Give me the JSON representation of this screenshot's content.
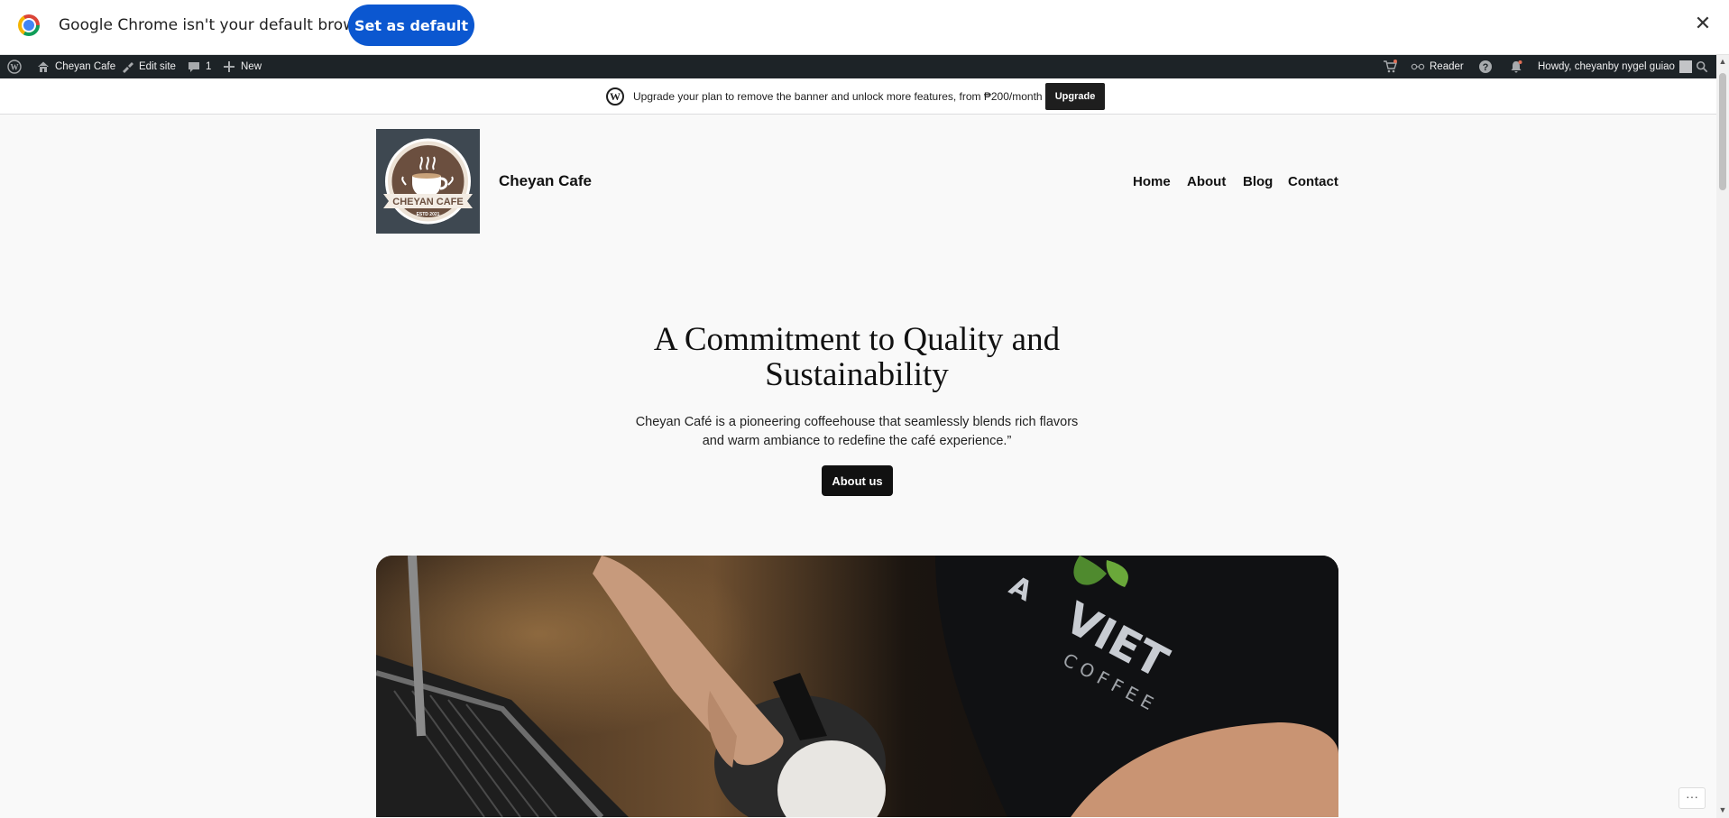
{
  "chrome_infobar": {
    "message": "Google Chrome isn't your default browser",
    "set_default_label": "Set as default",
    "close_glyph": "✕"
  },
  "admin_bar": {
    "site_name": "Cheyan Cafe",
    "edit_site": "Edit site",
    "comments_count": "1",
    "new_label": "New",
    "reader_label": "Reader",
    "howdy": "Howdy, cheyanby nygel guiao"
  },
  "upgrade_banner": {
    "text": "Upgrade your plan to remove the banner and unlock more features, from ₱200/month",
    "button": "Upgrade"
  },
  "site": {
    "title": "Cheyan Cafe",
    "logo_main_text": "CHEYAN CAFE",
    "logo_sub_text": "ESTD 2021",
    "nav": [
      "Home",
      "About",
      "Blog",
      "Contact"
    ]
  },
  "hero": {
    "title": "A Commitment to Quality and Sustainability",
    "description": "Cheyan Café is a pioneering coffeehouse that seamlessly blends rich flavors and warm ambiance to redefine the café experience.”",
    "button": "About us"
  },
  "colors": {
    "infobar_button": "#0b57d0",
    "admin_bar": "#1d2327",
    "page_bg": "#f9f9f9",
    "logo_bg": "#3e4851"
  }
}
